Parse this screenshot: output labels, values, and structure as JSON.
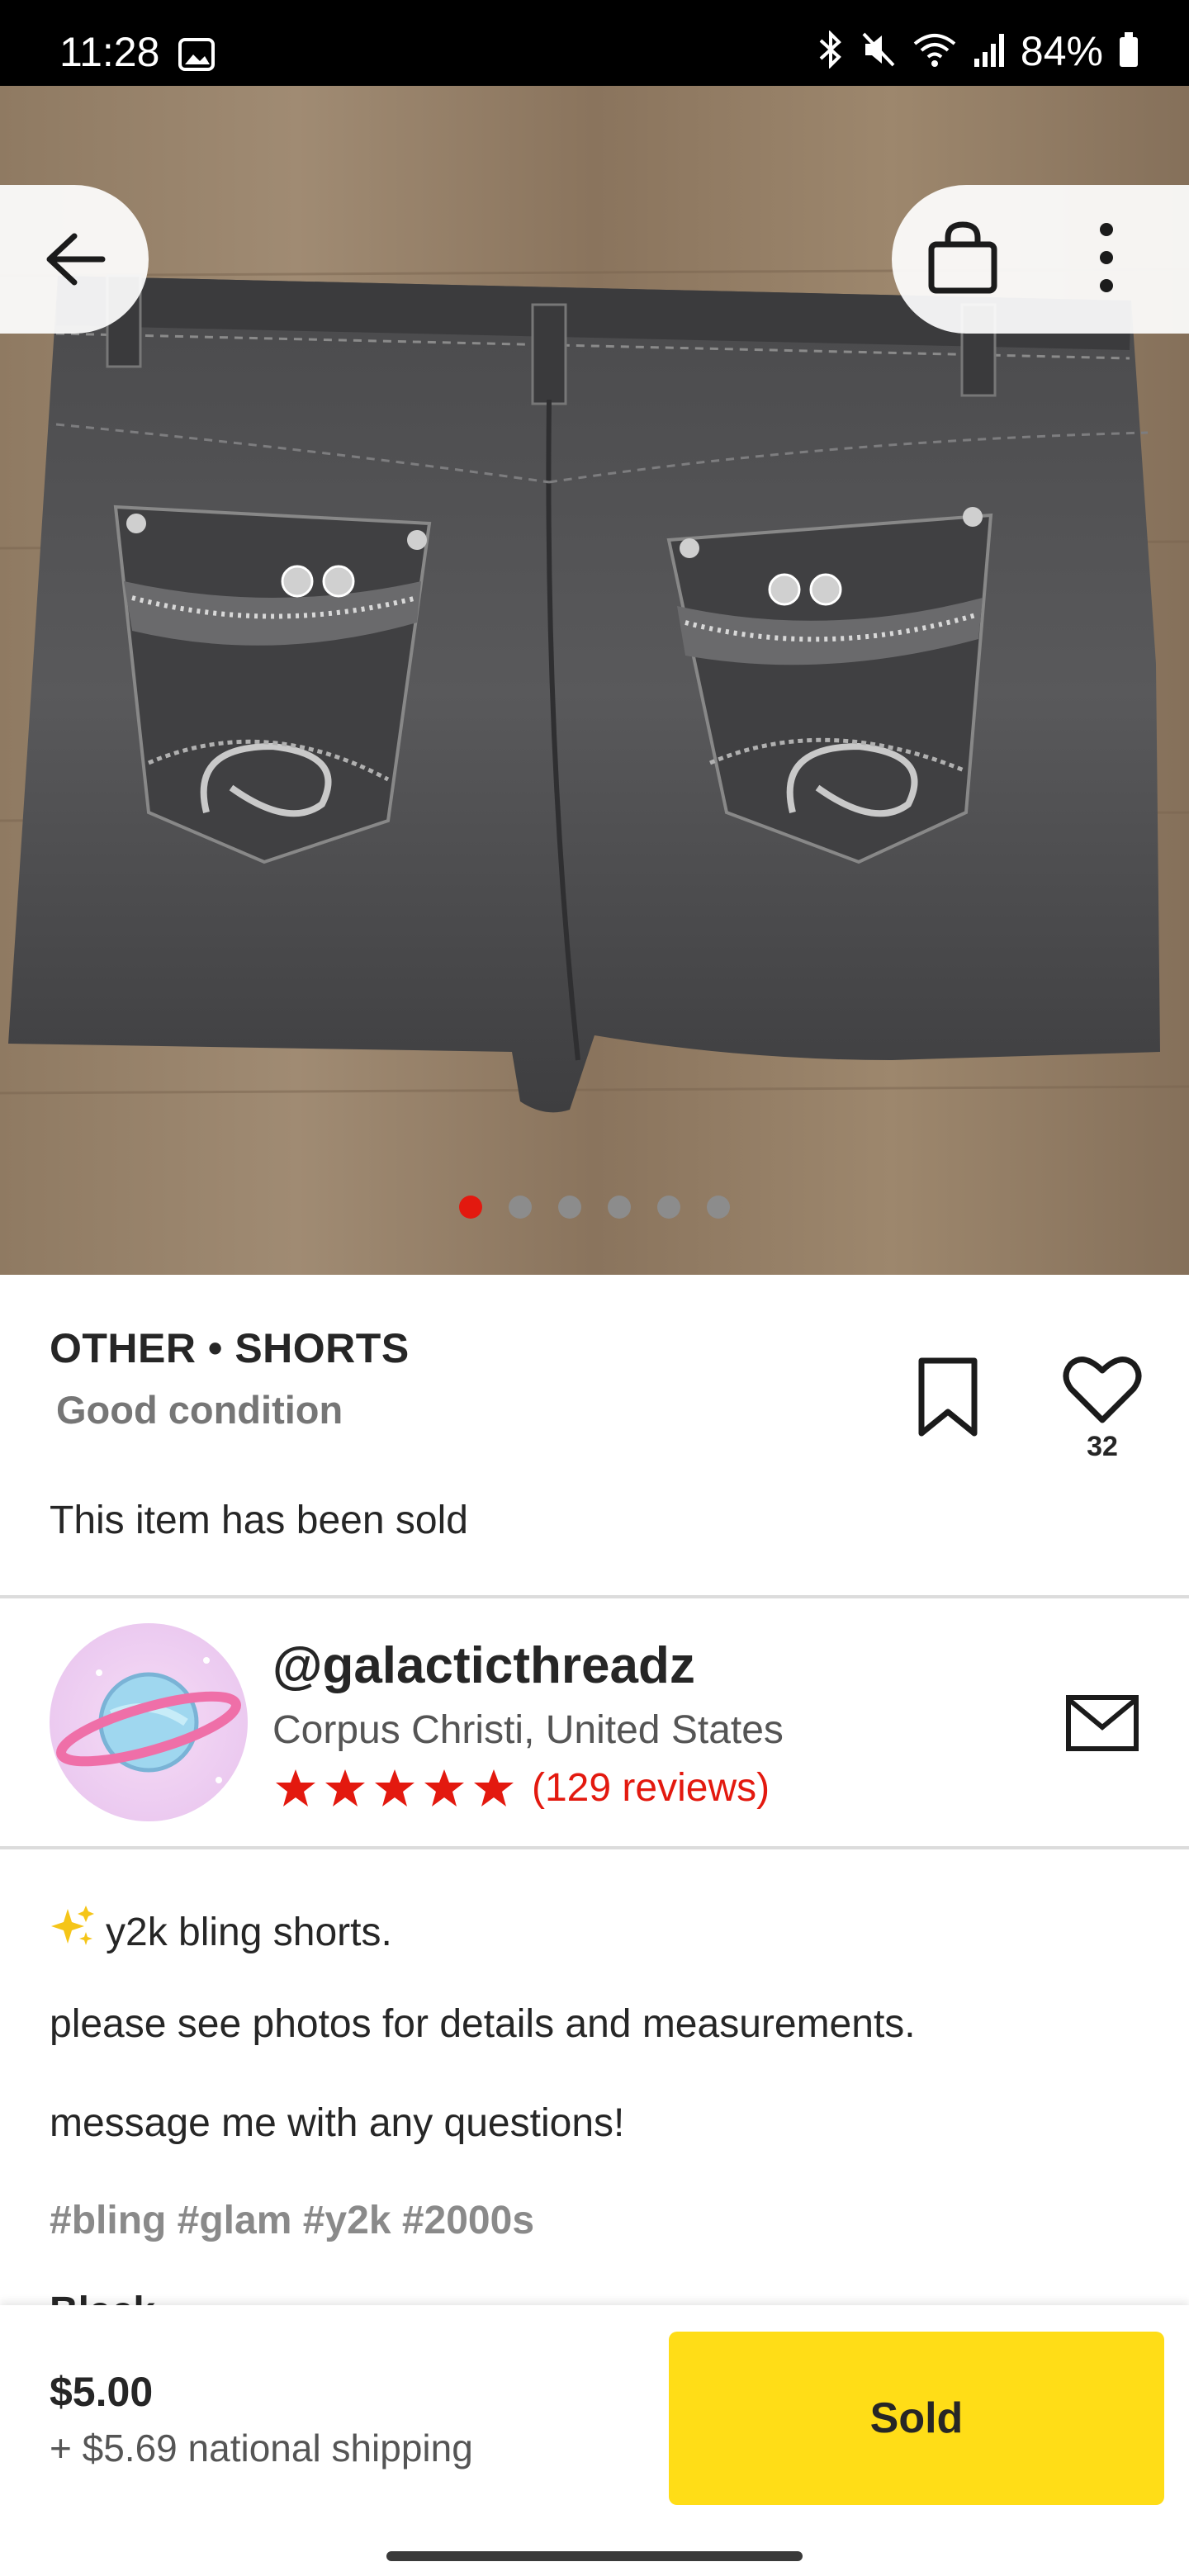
{
  "status_bar": {
    "time": "11:28",
    "battery": "84%",
    "icons": [
      "image-icon",
      "bluetooth-icon",
      "mute-icon",
      "wifi-icon",
      "signal-icon",
      "battery-icon"
    ]
  },
  "hero": {
    "image_alt": "Black denim shorts with embellished back pockets",
    "page_count": 6,
    "active_index": 0
  },
  "product": {
    "brand": "OTHER",
    "separator": "•",
    "category": "SHORTS",
    "condition": "Good condition",
    "likes": "32",
    "sold_note": "This item has been sold"
  },
  "seller": {
    "username": "@galacticthreadz",
    "location": "Corpus Christi, United States",
    "rating_stars": 5,
    "reviews": "(129 reviews)"
  },
  "description": {
    "line1": "y2k bling shorts.",
    "line2": "please see photos for details and measurements.",
    "line3": "message me with any questions!",
    "tags": "#bling #glam #y2k #2000s",
    "cutoff": "Black"
  },
  "purchase": {
    "price": "$5.00",
    "shipping": "+ $5.69 national shipping",
    "button_label": "Sold"
  },
  "colors": {
    "accent_red": "#e3190f",
    "button_yellow": "#ffdd17"
  }
}
